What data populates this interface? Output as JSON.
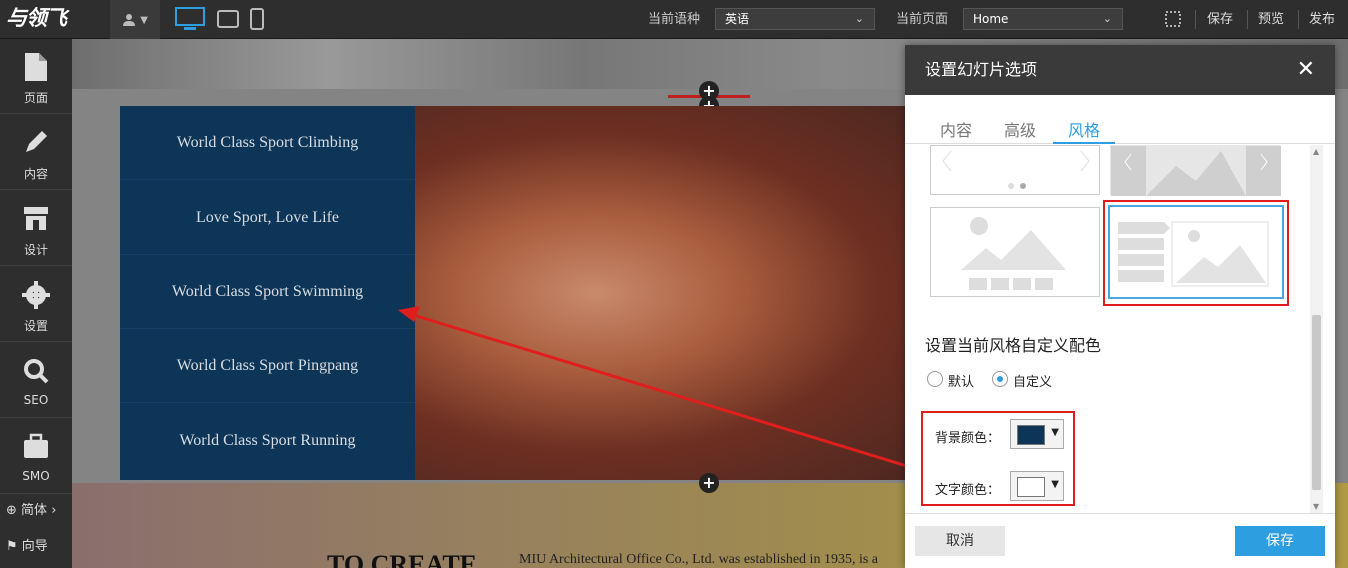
{
  "topbar": {
    "logo_text": "与领飞",
    "user_icon": "user-icon",
    "language_label": "当前语种",
    "language_value": "英语",
    "page_label": "当前页面",
    "page_value": "Home",
    "save": "保存",
    "preview": "预览",
    "publish": "发布"
  },
  "sidebar": {
    "items": [
      {
        "label": "页面",
        "icon": "page-icon"
      },
      {
        "label": "内容",
        "icon": "pencil-icon"
      },
      {
        "label": "设计",
        "icon": "store-icon"
      },
      {
        "label": "设置",
        "icon": "gear-icon"
      },
      {
        "label": "SEO",
        "icon": "search-icon"
      },
      {
        "label": "SMO",
        "icon": "briefcase-icon"
      }
    ],
    "lang_switch": "简体",
    "guide": "向导"
  },
  "canvas": {
    "slide_menu": [
      "World Class Sport Climbing",
      "Love Sport, Love Life",
      "World Class Sport Swimming",
      "World Class Sport Pingpang",
      "World Class Sport Running"
    ],
    "bottom_heading": "TO CREATE",
    "bottom_text": "MIU Architectural Office Co., Ltd. was established in 1935, is a"
  },
  "modal": {
    "title": "设置幻灯片选项",
    "tabs": [
      "内容",
      "高级",
      "风格"
    ],
    "active_tab": 2,
    "section_title": "设置当前风格自定义配色",
    "radio_default": "默认",
    "radio_custom": "自定义",
    "bg_color_label": "背景颜色：",
    "text_color_label": "文字颜色：",
    "bg_color": "#0d3558",
    "text_color": "#ffffff",
    "cancel": "取消",
    "save": "保存"
  },
  "colors": {
    "accent": "#2d9ee0",
    "highlight": "#e01e1e"
  }
}
